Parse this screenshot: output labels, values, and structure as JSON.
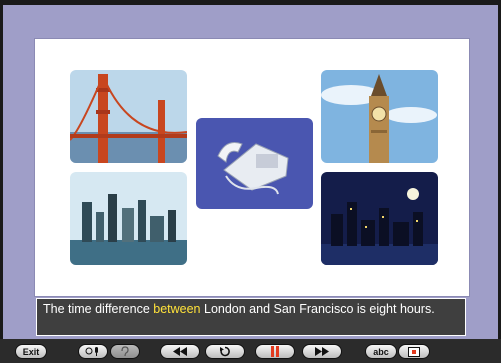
{
  "caption": {
    "part1": "The time difference ",
    "highlight": "between",
    "part2": " London and San Francisco is eight hours."
  },
  "toolbar": {
    "exit_label": "Exit",
    "subtitles_label": "abc"
  },
  "icons": {
    "exit": "exit-button",
    "record": "microphone-icon",
    "playback": "ear-icon",
    "rewind": "rewind-icon",
    "replay": "replay-icon",
    "pause": "pause-icon",
    "forward": "fast-forward-icon",
    "subtitles": "abc-icon",
    "stop": "stop-icon"
  },
  "colors": {
    "highlight": "#ffe23a",
    "caption_bg": "#3f3f3f",
    "window_bg": "#9f9ec8",
    "pause_accent": "#e23a1e"
  }
}
